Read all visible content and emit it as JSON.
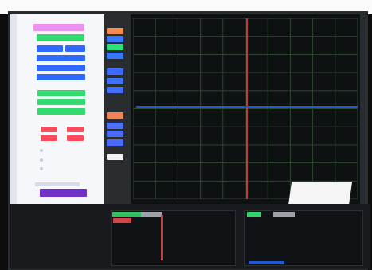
{
  "colors": {
    "accent_blue": "#2f69ff",
    "accent_green": "#31d96f",
    "accent_pink": "#ef91ef",
    "accent_red": "#ff4a5b",
    "accent_purple": "#7431c9",
    "grid": "#4b7b4b",
    "trace_blue": "#2457d3",
    "trace_red": "#c5383d",
    "background": "#0d0d0d"
  },
  "panel": {
    "icons": [
      "panel-settings-icon"
    ]
  }
}
